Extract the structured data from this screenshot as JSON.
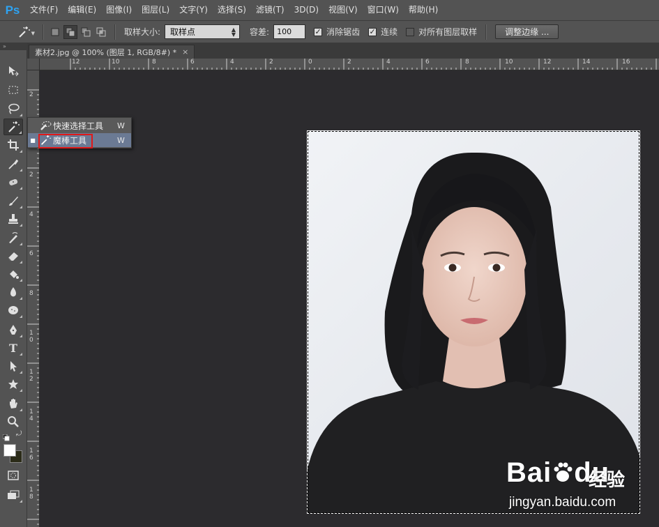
{
  "app": {
    "logo": "Ps",
    "menu": [
      "文件(F)",
      "编辑(E)",
      "图像(I)",
      "图层(L)",
      "文字(Y)",
      "选择(S)",
      "滤镜(T)",
      "3D(D)",
      "视图(V)",
      "窗口(W)",
      "帮助(H)"
    ]
  },
  "options": {
    "sample_size_label": "取样大小:",
    "sample_size_value": "取样点",
    "tolerance_label": "容差:",
    "tolerance_value": "100",
    "anti_alias_label": "消除锯齿",
    "anti_alias_checked": true,
    "contiguous_label": "连续",
    "contiguous_checked": true,
    "all_layers_label": "对所有图层取样",
    "all_layers_checked": false,
    "refine_edge_label": "调整边缘 ..."
  },
  "document": {
    "tab_title": "素材2.jpg @ 100% (图层 1, RGB/8#) *",
    "close_glyph": "×"
  },
  "rulers": {
    "horizontal": [
      "12",
      "10",
      "8",
      "6",
      "4",
      "2",
      "0",
      "2",
      "4",
      "6",
      "8",
      "10",
      "12",
      "14",
      "16"
    ],
    "vertical": [
      "2",
      "0",
      "2",
      "4",
      "6",
      "8",
      "1\n0",
      "1\n2",
      "1\n4",
      "1\n6",
      "1\n8"
    ]
  },
  "flyout": {
    "items": [
      {
        "label": "快速选择工具",
        "shortcut": "W",
        "selected": false
      },
      {
        "label": "魔棒工具",
        "shortcut": "W",
        "selected": true
      }
    ]
  },
  "watermark": {
    "brand": "Bai",
    "brand_suffix": "du",
    "jingyan": "经验",
    "url": "jingyan.baidu.com"
  },
  "colors": {
    "foreground": "#ffffff",
    "background": "#2b2b18",
    "ps_blue": "#2ea3f2",
    "highlight_red": "#e01818"
  }
}
